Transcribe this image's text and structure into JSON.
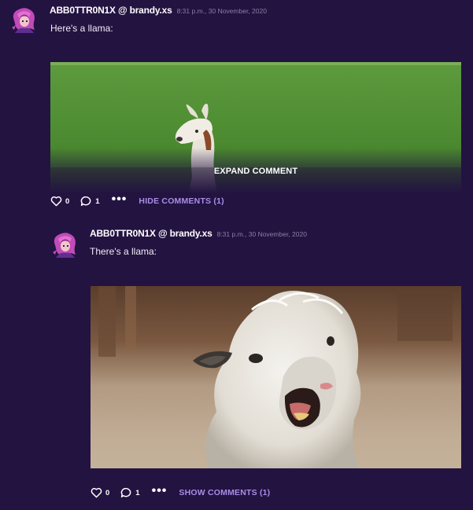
{
  "posts": [
    {
      "author": "ABB0TTR0N1X @ brandy.xs",
      "timestamp": "8:31 p.m., 30 November, 2020",
      "text": "Here's a llama:",
      "likes": "0",
      "comments": "1",
      "more_icon": "•••",
      "toggle_label": "HIDE COMMENTS (1)",
      "expand_label": "EXPAND COMMENT"
    },
    {
      "author": "ABB0TTR0N1X @ brandy.xs",
      "timestamp": "8:31 p.m., 30 November, 2020",
      "text": "There's a llama:",
      "likes": "0",
      "comments": "1",
      "more_icon": "•••",
      "toggle_label": "SHOW COMMENTS (1)"
    }
  ],
  "colors": {
    "background": "#231341",
    "accent": "#a98ee6",
    "timestamp": "#8c7fa3"
  },
  "icons": [
    "avatar",
    "heart-icon",
    "comment-bubble-icon",
    "more-icon"
  ]
}
